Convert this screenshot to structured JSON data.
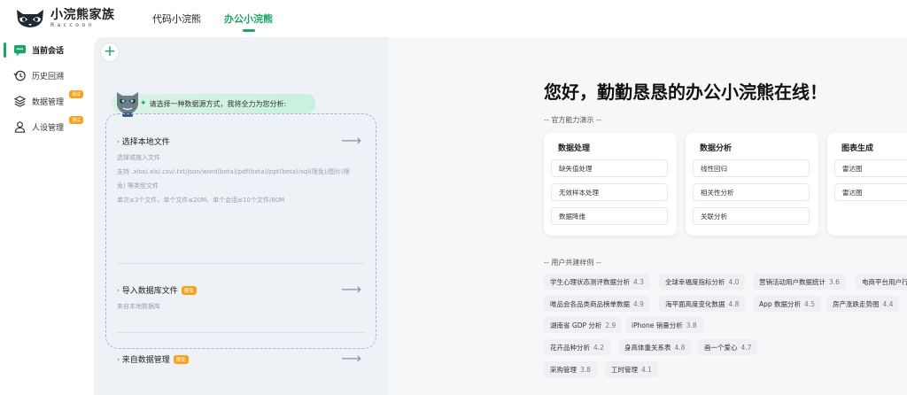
{
  "app": {
    "title": "小浣熊家族",
    "subtitle": "Raccoon"
  },
  "nav": {
    "tabs": [
      {
        "label": "代码小浣熊"
      },
      {
        "label": "办公小浣熊"
      }
    ]
  },
  "sidebar": {
    "items": [
      {
        "label": "当前会话"
      },
      {
        "label": "历史回溯"
      },
      {
        "label": "数据管理",
        "badge": "测试"
      },
      {
        "label": "人设管理",
        "badge": "测试"
      }
    ]
  },
  "chat": {
    "prompt": "请选择一种数据源方式，我将全力为您分析:",
    "options": [
      {
        "title": "· 选择本地文件",
        "lines": [
          "选择或拖入文件",
          "支持 .xlsx/.xls/.csv/.txt/json/word(beta)/pdf(beta)/ppt(beta)/sql(限免)/图片(限免) 等类型文件",
          "单次≤3个文件，单个文件≤20M、单个会话≤10个文件/80M"
        ]
      },
      {
        "title": "· 导入数据库文件",
        "tag": "限免",
        "lines": [
          "来自本地数据库"
        ]
      },
      {
        "title": "· 来自数据管理",
        "tag": "限免",
        "lines": []
      }
    ],
    "arrow": "⟶"
  },
  "main": {
    "greeting": "您好，勤勤恳恳的办公小浣熊在线！",
    "official_label": "-- 官方能力演示 --",
    "capabilities": [
      {
        "title": "数据处理",
        "items": [
          "缺失值处理",
          "无效样本处理",
          "数据降维"
        ]
      },
      {
        "title": "数据分析",
        "items": [
          "线性回归",
          "相关性分析",
          "关联分析"
        ]
      },
      {
        "title": "图表生成",
        "items": [
          "雷达图",
          "雷达图"
        ]
      }
    ],
    "community_label": "-- 用户共建样例 --",
    "examples": [
      {
        "label": "学生心理状态测评数据分析",
        "score": "4.3"
      },
      {
        "label": "全球幸福度指标分析",
        "score": "4.0"
      },
      {
        "label": "营销活动用户数据统计",
        "score": "3.6"
      },
      {
        "label": "电商平台用户行为",
        "score": ""
      },
      {
        "label": "唯品会各品类商品榜单数据",
        "score": "4.9"
      },
      {
        "label": "海平面高度变化数据",
        "score": "4.8"
      },
      {
        "label": "App 数据分析",
        "score": "4.5"
      },
      {
        "label": "房产涨跌走势图",
        "score": "4.4"
      },
      {
        "label": "湖南省 GDP 分析",
        "score": "2.9"
      },
      {
        "label": "iPhone 销量分析",
        "score": "3.8"
      },
      {
        "label": "花卉品种分析",
        "score": "4.2"
      },
      {
        "label": "身高体重关系表",
        "score": "4.8"
      },
      {
        "label": "画一个爱心",
        "score": "4.7"
      },
      {
        "label": "采购管理",
        "score": "3.8"
      },
      {
        "label": "工时管理",
        "score": "4.1"
      }
    ]
  },
  "colors": {
    "accent": "#1aa564",
    "badge": "#f7a21a"
  }
}
